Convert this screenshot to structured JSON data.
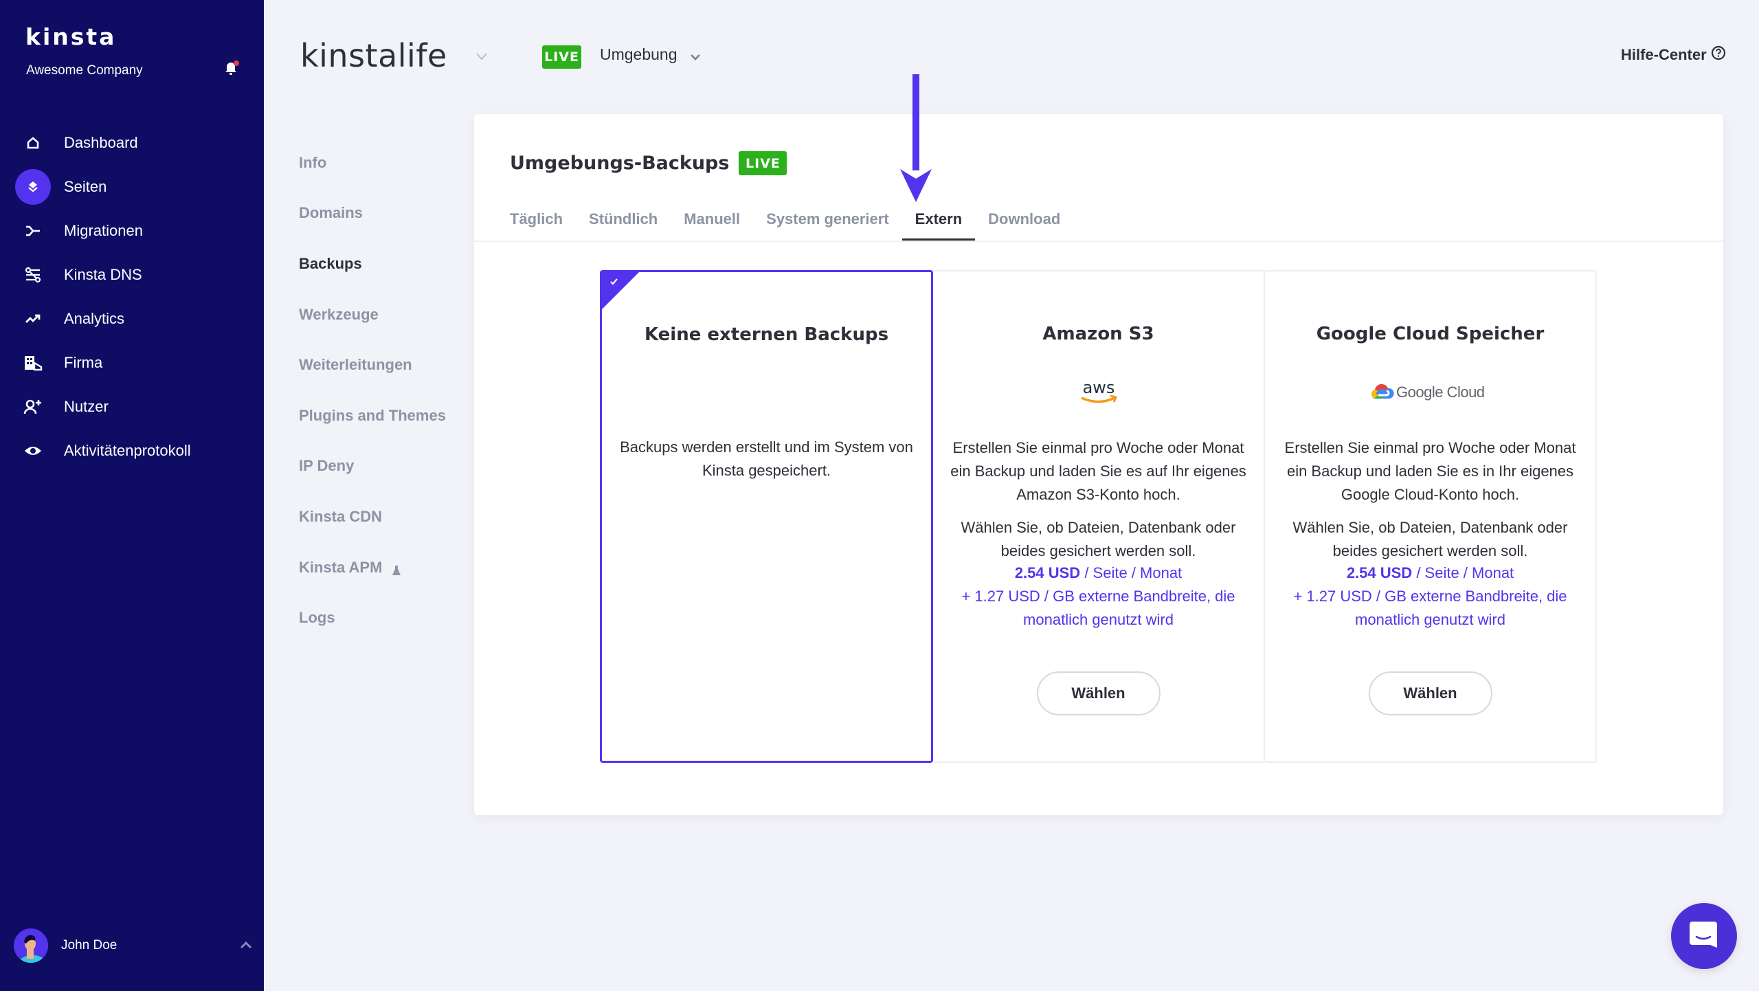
{
  "sidebar": {
    "brand": "kinsta",
    "company": "Awesome Company",
    "items": [
      {
        "label": "Dashboard",
        "icon": "home-icon"
      },
      {
        "label": "Seiten",
        "icon": "layers-icon",
        "active": true
      },
      {
        "label": "Migrationen",
        "icon": "migration-icon"
      },
      {
        "label": "Kinsta DNS",
        "icon": "dns-icon"
      },
      {
        "label": "Analytics",
        "icon": "trending-up-icon"
      },
      {
        "label": "Firma",
        "icon": "building-icon"
      },
      {
        "label": "Nutzer",
        "icon": "user-add-icon"
      },
      {
        "label": "Aktivitätenprotokoll",
        "icon": "eye-icon"
      }
    ],
    "user": {
      "name": "John Doe"
    }
  },
  "header": {
    "site_name": "kinstalife",
    "env_badge": "LIVE",
    "env_label": "Umgebung",
    "help_label": "Hilfe-Center"
  },
  "subnav": {
    "items": [
      {
        "label": "Info"
      },
      {
        "label": "Domains"
      },
      {
        "label": "Backups",
        "active": true
      },
      {
        "label": "Werkzeuge"
      },
      {
        "label": "Weiterleitungen"
      },
      {
        "label": "Plugins and Themes"
      },
      {
        "label": "IP Deny"
      },
      {
        "label": "Kinsta CDN"
      },
      {
        "label": "Kinsta APM"
      },
      {
        "label": "Logs"
      }
    ]
  },
  "panel": {
    "title": "Umgebungs-Backups",
    "badge": "LIVE",
    "tabs": [
      {
        "label": "Täglich"
      },
      {
        "label": "Stündlich"
      },
      {
        "label": "Manuell"
      },
      {
        "label": "System generiert"
      },
      {
        "label": "Extern",
        "active": true
      },
      {
        "label": "Download"
      }
    ],
    "cards": [
      {
        "title": "Keine externen Backups",
        "desc1": "Backups werden erstellt und im System von Kinsta gespeichert.",
        "selected": true
      },
      {
        "title": "Amazon S3",
        "logo_text": "aws",
        "desc1": "Erstellen Sie einmal pro Woche oder Monat ein Backup und laden Sie es auf Ihr eigenes Amazon S3-Konto hoch.",
        "desc2": "Wählen Sie, ob Dateien, Datenbank oder beides gesichert werden soll.",
        "price_amount": "2.54 USD",
        "price_unit": " / Seite / Monat",
        "price_extra": "+ 1.27 USD / GB externe Bandbreite, die monatlich genutzt wird",
        "button": "Wählen"
      },
      {
        "title": "Google Cloud Speicher",
        "logo_text": "Google Cloud",
        "desc1": "Erstellen Sie einmal pro Woche oder Monat ein Backup und laden Sie es in Ihr eigenes Google Cloud-Konto hoch.",
        "desc2": "Wählen Sie, ob Dateien, Datenbank oder beides gesichert werden soll.",
        "price_amount": "2.54 USD",
        "price_unit": " / Seite / Monat",
        "price_extra": "+ 1.27 USD / GB externe Bandbreite, die monatlich genutzt wird",
        "button": "Wählen"
      }
    ]
  },
  "colors": {
    "sidebar_bg": "#0e0c63",
    "accent": "#5333ed",
    "live_green": "#2cb01b",
    "notification_dot": "#e53e3e"
  }
}
